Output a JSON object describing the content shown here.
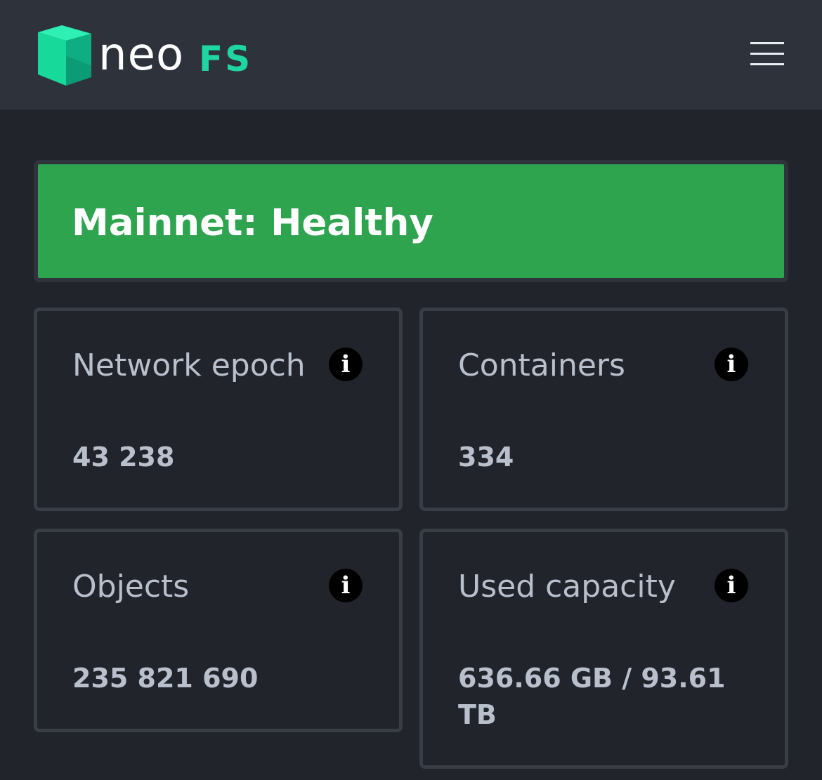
{
  "header": {
    "logo": {
      "neo": "neo",
      "fs": "FS"
    },
    "menu_icon": "hamburger-menu-icon"
  },
  "status": {
    "text": "Mainnet: Healthy",
    "color": "#2ea44f"
  },
  "stats": [
    {
      "label": "Network epoch",
      "value": "43 238",
      "icon": "info-icon"
    },
    {
      "label": "Containers",
      "value": "334",
      "icon": "info-icon"
    },
    {
      "label": "Objects",
      "value": "235 821 690",
      "icon": "info-icon"
    },
    {
      "label": "Used capacity",
      "value": "636.66 GB / 93.61 TB",
      "icon": "info-icon"
    }
  ],
  "colors": {
    "background": "#21242b",
    "header_background": "#2e333b",
    "accent": "#1fd6a0",
    "text": "#b9c0cc"
  }
}
